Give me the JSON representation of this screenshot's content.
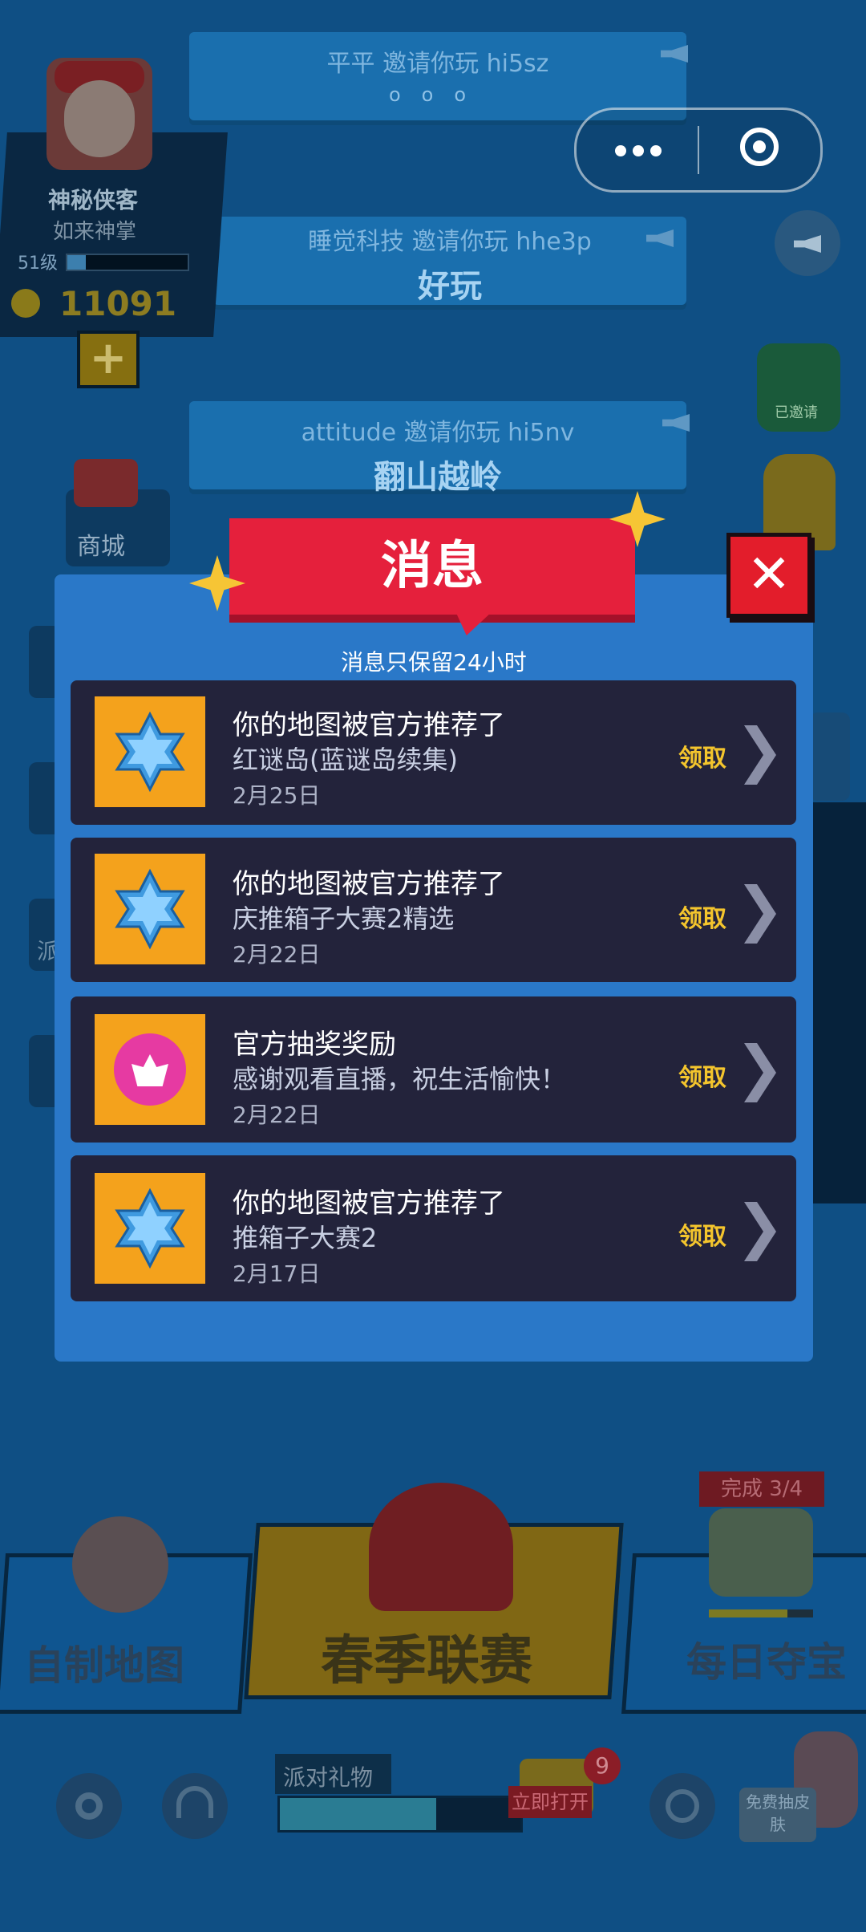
{
  "background": {
    "invites": [
      {
        "line": "平平 邀请你玩 hi5sz",
        "msg": "",
        "dots": "ooo"
      },
      {
        "line": "睡觉科技 邀请你玩 hhe3p",
        "msg": "好玩"
      },
      {
        "line": "attitude 邀请你玩 hi5nv",
        "msg": "翻山越岭"
      }
    ],
    "profile": {
      "name": "神秘侠客",
      "title": "如来神掌",
      "level": "51级",
      "level_progress": 0.15,
      "coins": "11091"
    },
    "shop_label": "商城",
    "status_badge": "已邀请",
    "side_partial_char": "派",
    "bottom": {
      "custom_map": "自制地图",
      "spring_league": "春季联赛",
      "daily_treasure": "每日夺宝",
      "progress_badge": "完成 3/4",
      "party_gift": "派对礼物",
      "party_gift_progress": 0.65,
      "open_now": "立即打开",
      "gift_count": "9",
      "free_skin": "免费抽皮肤"
    }
  },
  "dialog": {
    "title": "消息",
    "subtitle": "消息只保留24小时",
    "messages": [
      {
        "title": "你的地图被官方推荐了",
        "detail": "红谜岛(蓝谜岛续集)",
        "date": "2月25日",
        "action": "领取",
        "icon": "blue-star-icon"
      },
      {
        "title": "你的地图被官方推荐了",
        "detail": "庆推箱子大赛2精选",
        "date": "2月22日",
        "action": "领取",
        "icon": "blue-star-icon"
      },
      {
        "title": "官方抽奖奖励",
        "detail": "感谢观看直播，祝生活愉快！",
        "date": "2月22日",
        "action": "领取",
        "icon": "lotus-icon"
      },
      {
        "title": "你的地图被官方推荐了",
        "detail": "推箱子大赛2",
        "date": "2月17日",
        "action": "领取",
        "icon": "blue-star-icon"
      }
    ]
  },
  "colors": {
    "dialog_bg": "#2a78c8",
    "banner_red": "#e5203c",
    "claim_gold": "#f4c52d",
    "thumb_orange": "#f4a21c"
  }
}
